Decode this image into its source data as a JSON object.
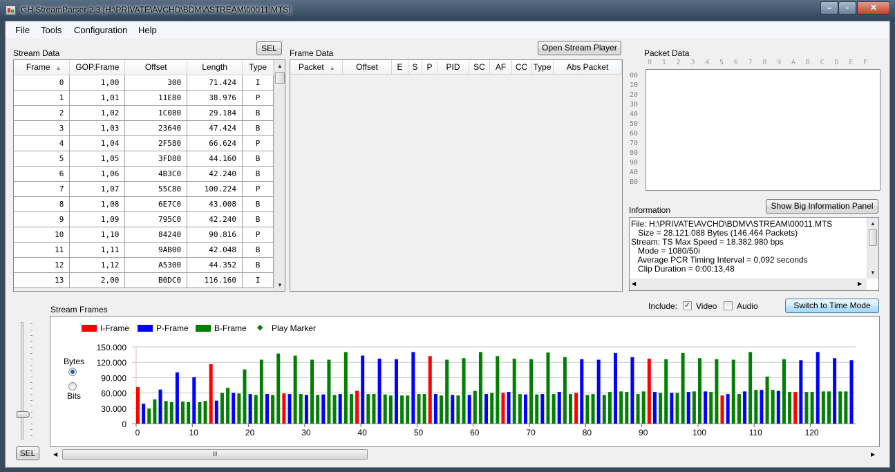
{
  "window": {
    "title": "GH StreamParser 2.3 [H:\\PRIVATE\\AVCHD\\BDMV\\STREAM\\00011.MTS]"
  },
  "menu": {
    "file": "File",
    "tools": "Tools",
    "configuration": "Configuration",
    "help": "Help"
  },
  "stream_data": {
    "label": "Stream Data",
    "sel_button": "SEL",
    "columns": [
      "Frame",
      "GOP.Frame",
      "Offset",
      "Length",
      "Type"
    ],
    "rows": [
      [
        "0",
        "1,00",
        "300",
        "71.424",
        "I"
      ],
      [
        "1",
        "1,01",
        "11E80",
        "38.976",
        "P"
      ],
      [
        "2",
        "1,02",
        "1C080",
        "29.184",
        "B"
      ],
      [
        "3",
        "1,03",
        "23640",
        "47.424",
        "B"
      ],
      [
        "4",
        "1,04",
        "2F580",
        "66.624",
        "P"
      ],
      [
        "5",
        "1,05",
        "3FD80",
        "44.160",
        "B"
      ],
      [
        "6",
        "1,06",
        "4B3C0",
        "42.240",
        "B"
      ],
      [
        "7",
        "1,07",
        "55C80",
        "100.224",
        "P"
      ],
      [
        "8",
        "1,08",
        "6E7C0",
        "43.008",
        "B"
      ],
      [
        "9",
        "1,09",
        "795C0",
        "42.240",
        "B"
      ],
      [
        "10",
        "1,10",
        "84240",
        "90.816",
        "P"
      ],
      [
        "11",
        "1,11",
        "9AB00",
        "42.048",
        "B"
      ],
      [
        "12",
        "1,12",
        "A5300",
        "44.352",
        "B"
      ],
      [
        "13",
        "2,00",
        "B0DC0",
        "116.160",
        "I"
      ]
    ]
  },
  "frame_data": {
    "label": "Frame Data",
    "open_player_button": "Open Stream Player",
    "columns": [
      "Packet",
      "Offset",
      "E",
      "S",
      "P",
      "PID",
      "SC",
      "AF",
      "CC",
      "Type",
      "Abs Packet"
    ]
  },
  "packet_data": {
    "label": "Packet Data",
    "col_headers": [
      "0",
      "1",
      "2",
      "3",
      "4",
      "5",
      "6",
      "7",
      "8",
      "9",
      "A",
      "B",
      "C",
      "D",
      "E",
      "F"
    ],
    "row_headers": [
      "00",
      "10",
      "20",
      "30",
      "40",
      "50",
      "60",
      "70",
      "80",
      "90",
      "A0",
      "B0"
    ]
  },
  "information": {
    "label": "Information",
    "big_panel_button": "Show Big Information Panel",
    "lines": [
      "File: H:\\PRIVATE\\AVCHD\\BDMV\\STREAM\\00011.MTS",
      "   Size = 28.121.088 Bytes (146.464 Packets)",
      "Stream: TS Max Speed = 18.382.980 bps",
      "   Mode = 1080/50i",
      "   Average PCR Timing Interval = 0,092 seconds",
      "   Clip Duration = 0:00:13,48"
    ]
  },
  "stream_frames": {
    "label": "Stream Frames",
    "include_label": "Include:",
    "video_label": "Video",
    "video_checked": true,
    "audio_label": "Audio",
    "audio_checked": false,
    "time_mode_button": "Switch to Time Mode",
    "unit_bytes": "Bytes",
    "unit_bits": "Bits",
    "unit_selected": "Bytes",
    "sel_button": "SEL",
    "scroll_grip": "III"
  },
  "chart_data": {
    "type": "bar",
    "legend": [
      {
        "name": "I-Frame",
        "color": "#ff0000"
      },
      {
        "name": "P-Frame",
        "color": "#0000ff"
      },
      {
        "name": "B-Frame",
        "color": "#008000"
      },
      {
        "name": "Play Marker",
        "color": "#008000"
      }
    ],
    "ylim": [
      0,
      150000
    ],
    "yticks": [
      "150.000",
      "120.000",
      "90.000",
      "60.000",
      "30.000",
      "0"
    ],
    "ytick_values": [
      150000,
      120000,
      90000,
      60000,
      30000,
      0
    ],
    "xticks": [
      0,
      10,
      20,
      30,
      40,
      50,
      60,
      70,
      80,
      90,
      100,
      110,
      120
    ],
    "grid": true,
    "play_marker_frame": 0,
    "types": "IPBBPBBPBBPBBIPBBPBBPBBPBBIPBBPBBPBBPBBIPBBPBBPBBPBBIPBBPBBPBBPBBIPBBPBBPBBPBBIPBBPBBPBBPBBIPBBPBBPBBPBBIPBBPBBPBBPBBIPBBPBBPBBPBBIPBBPB",
    "values": [
      71424,
      38976,
      29184,
      47424,
      66624,
      44160,
      42240,
      100224,
      43008,
      42240,
      90816,
      42048,
      44352,
      116160,
      45000,
      60000,
      70000,
      60000,
      59000,
      106000,
      58000,
      56000,
      125000,
      58000,
      56000,
      137000,
      59000,
      58000,
      133000,
      58000,
      56000,
      125000,
      56000,
      57000,
      125000,
      56000,
      58000,
      140000,
      58000,
      64000,
      133000,
      58000,
      58000,
      127000,
      57000,
      55000,
      126000,
      55000,
      55000,
      140000,
      58000,
      58000,
      132000,
      58000,
      55000,
      125000,
      56000,
      55000,
      128000,
      56000,
      64000,
      140000,
      58000,
      60000,
      132000,
      60000,
      62000,
      127000,
      58000,
      57000,
      126000,
      57000,
      58000,
      139000,
      58000,
      62000,
      130000,
      58000,
      60000,
      126000,
      56000,
      58000,
      125000,
      56000,
      62000,
      138000,
      63000,
      62000,
      130000,
      58000,
      63000,
      127000,
      62000,
      60000,
      126000,
      60000,
      60000,
      138000,
      62000,
      63000,
      128000,
      63000,
      62000,
      126000,
      55000,
      58000,
      125000,
      58000,
      63000,
      140000,
      66000,
      66000,
      92000,
      66000,
      64000,
      126000,
      62000,
      62000,
      124000,
      62000,
      62000,
      140000,
      63000,
      63000,
      128000,
      63000,
      63000,
      124000
    ]
  }
}
